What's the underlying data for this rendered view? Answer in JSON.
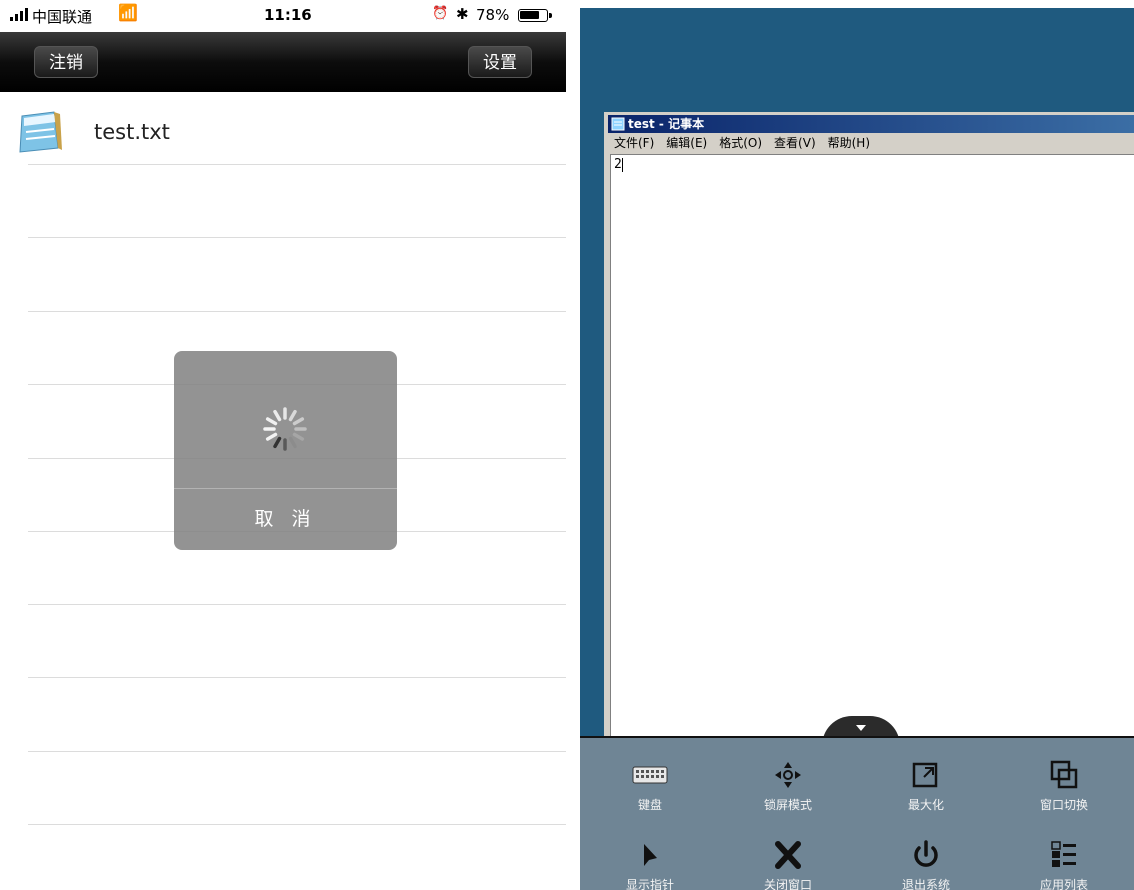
{
  "status_bar": {
    "carrier": "中国联通",
    "time": "11:16",
    "battery_percent_label": "78%",
    "battery_level": 0.78
  },
  "nav": {
    "logout_label": "注销",
    "settings_label": "设置"
  },
  "files": [
    {
      "name": "test.txt",
      "icon": "notepad-file-icon"
    }
  ],
  "loading_dialog": {
    "cancel_label": "取 消"
  },
  "notepad": {
    "title": "test - 记事本",
    "menu": [
      "文件(F)",
      "编辑(E)",
      "格式(O)",
      "查看(V)",
      "帮助(H)"
    ],
    "content": "2"
  },
  "toolbar": {
    "items": [
      {
        "label": "键盘",
        "icon": "keyboard-icon"
      },
      {
        "label": "锁屏模式",
        "icon": "move-icon"
      },
      {
        "label": "最大化",
        "icon": "maximize-icon"
      },
      {
        "label": "窗口切换",
        "icon": "window-switch-icon"
      },
      {
        "label": "显示指针",
        "icon": "pointer-icon"
      },
      {
        "label": "关闭窗口",
        "icon": "close-icon"
      },
      {
        "label": "退出系统",
        "icon": "power-icon"
      },
      {
        "label": "应用列表",
        "icon": "app-list-icon"
      }
    ]
  },
  "colors": {
    "desktop": "#1f5a7f",
    "panel": "#6f8595",
    "titlebar": "#0a246a"
  }
}
